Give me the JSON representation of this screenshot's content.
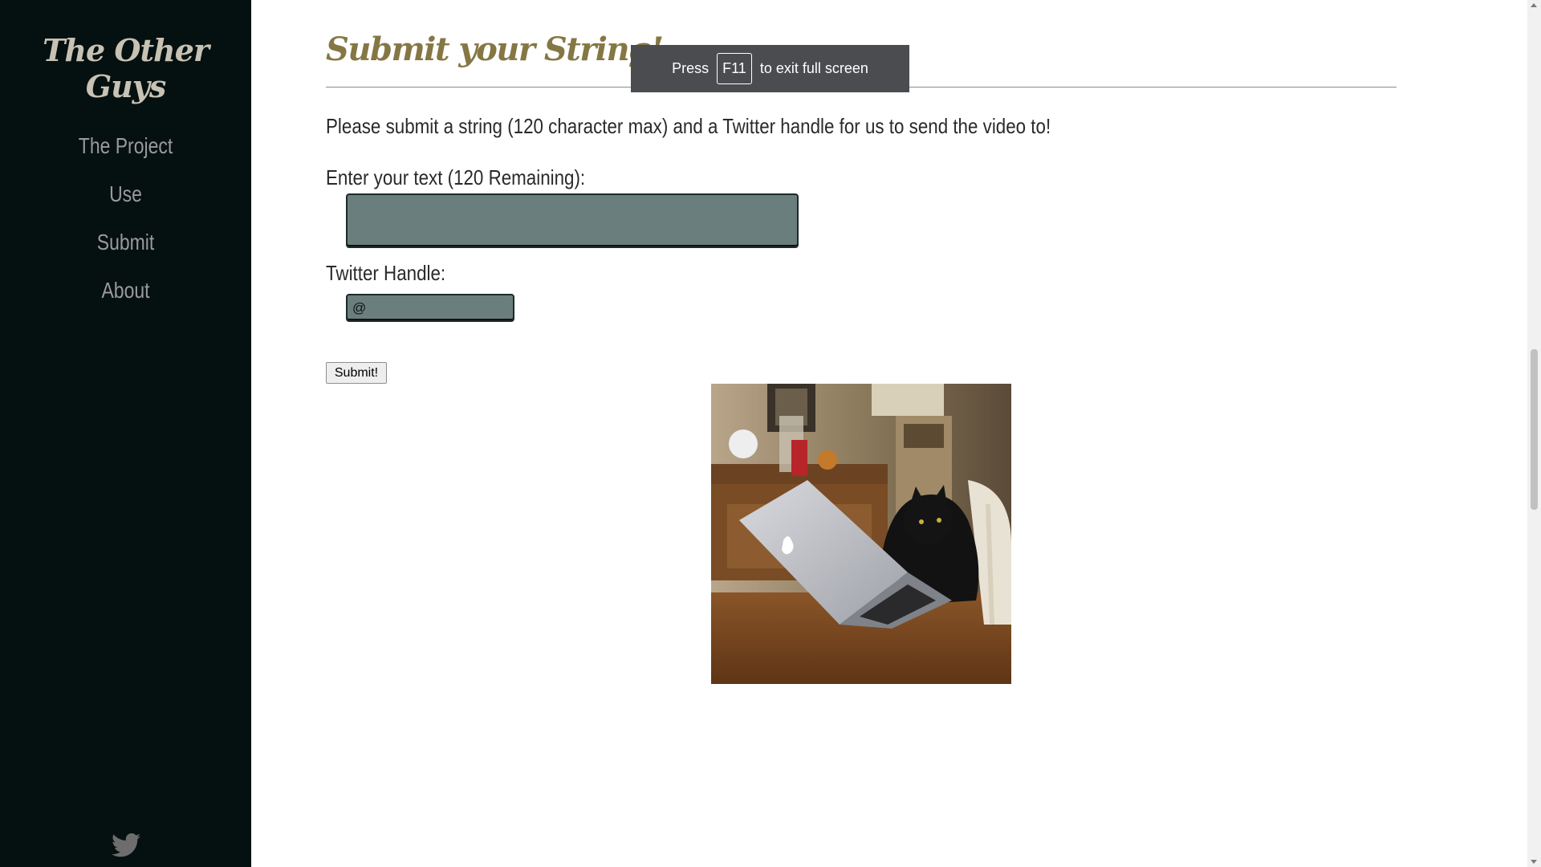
{
  "sidebar": {
    "brand": "The Other Guys",
    "nav": [
      {
        "label": "The Project"
      },
      {
        "label": "Use"
      },
      {
        "label": "Submit"
      },
      {
        "label": "About"
      }
    ],
    "footer_icon": "twitter-icon"
  },
  "main": {
    "title": "Submit your String!",
    "intro": "Please submit a string (120 character max) and a Twitter handle for us to send the video to!",
    "text_label": "Enter your text (120 Remaining):",
    "text_value": "",
    "handle_label": "Twitter Handle:",
    "handle_value": "@",
    "submit_label": "Submit!"
  },
  "fullscreen_toast": {
    "before": "Press",
    "key": "F11",
    "after": "to exit full screen"
  },
  "colors": {
    "sidebar_bg": "#051011",
    "title": "#857744",
    "input_bg": "#6a7f7d"
  }
}
